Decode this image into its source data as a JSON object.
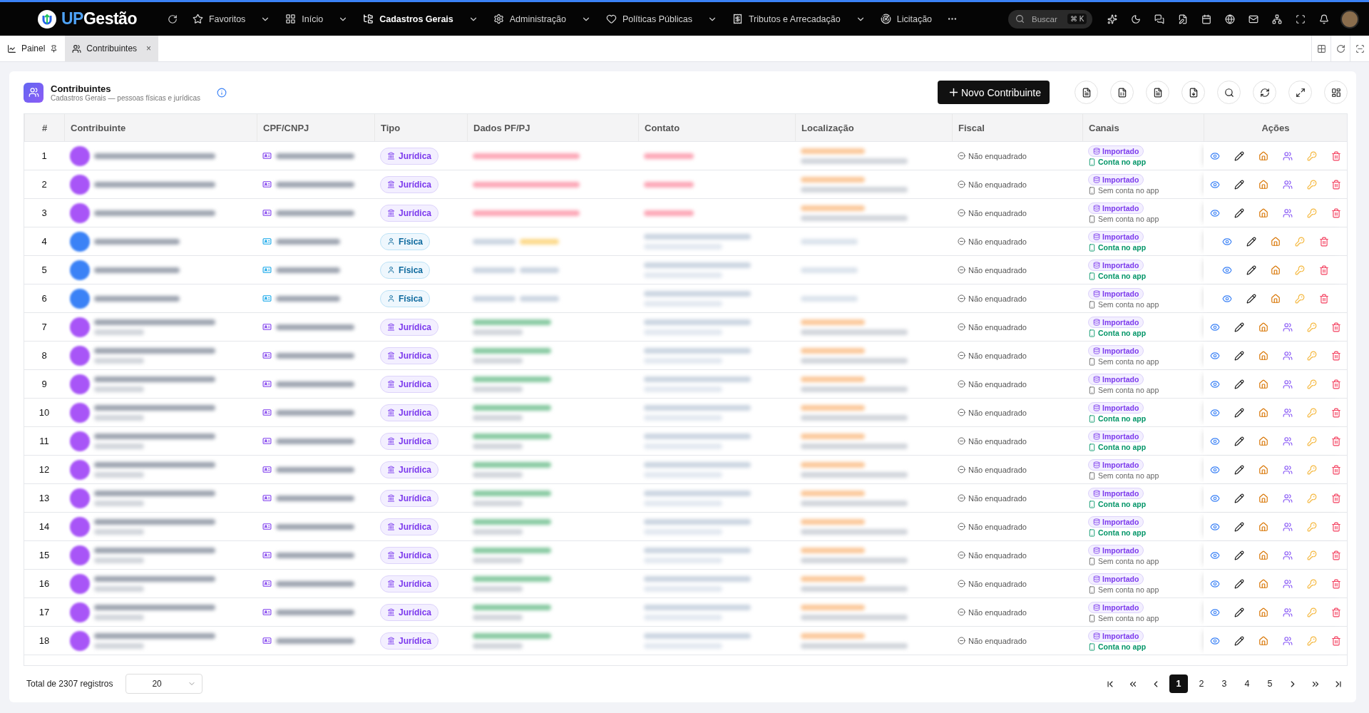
{
  "topbar": {
    "logo_prefix": "UP",
    "logo_suffix": "Gestão",
    "menu": [
      {
        "label": "Favoritos",
        "kind": "star",
        "selected": false
      },
      {
        "label": "Início",
        "kind": "grid",
        "selected": false
      },
      {
        "label": "Cadastros Gerais",
        "kind": "tree",
        "selected": true
      },
      {
        "label": "Administração",
        "kind": "gear",
        "selected": false
      },
      {
        "label": "Políticas Públicas",
        "kind": "heart",
        "selected": false
      },
      {
        "label": "Tributos e Arrecadação",
        "kind": "receipt",
        "selected": false
      },
      {
        "label": "Licitação",
        "kind": "radar",
        "selected": false
      }
    ],
    "search": {
      "placeholder": "Buscar",
      "shortcut": "⌘ K"
    }
  },
  "tabs": [
    {
      "label": "Painel",
      "kind": "pinned",
      "selected": false
    },
    {
      "label": "Contribuintes",
      "kind": "closable",
      "selected": true,
      "close": "×"
    }
  ],
  "page": {
    "title": "Contribuintes",
    "subtitle": "Cadastros Gerais — pessoas físicas e jurídicas",
    "new_button": "Novo Contribuinte"
  },
  "table": {
    "columns": [
      "#",
      "Contribuinte",
      "CPF/CNPJ",
      "Tipo",
      "Dados PF/PJ",
      "Contato",
      "Localização",
      "Fiscal",
      "Canais",
      "Ações"
    ],
    "rows": [
      {
        "number": "1",
        "tipo": {
          "kind": "juridica",
          "label": "Jurídica"
        },
        "fiscal": "Não enquadrado",
        "source": "Importado",
        "app": {
          "linked": true,
          "label": "Conta no app"
        }
      },
      {
        "number": "2",
        "tipo": {
          "kind": "juridica",
          "label": "Jurídica"
        },
        "fiscal": "Não enquadrado",
        "source": "Importado",
        "app": {
          "linked": false,
          "label": "Sem conta no app"
        }
      },
      {
        "number": "3",
        "tipo": {
          "kind": "juridica",
          "label": "Jurídica"
        },
        "fiscal": "Não enquadrado",
        "source": "Importado",
        "app": {
          "linked": false,
          "label": "Sem conta no app"
        }
      },
      {
        "number": "4",
        "tipo": {
          "kind": "fisica",
          "label": "Física"
        },
        "fiscal": "Não enquadrado",
        "source": "Importado",
        "app": {
          "linked": true,
          "label": "Conta no app"
        }
      },
      {
        "number": "5",
        "tipo": {
          "kind": "fisica",
          "label": "Física"
        },
        "fiscal": "Não enquadrado",
        "source": "Importado",
        "app": {
          "linked": true,
          "label": "Conta no app"
        }
      },
      {
        "number": "6",
        "tipo": {
          "kind": "fisica",
          "label": "Física"
        },
        "fiscal": "Não enquadrado",
        "source": "Importado",
        "app": {
          "linked": false,
          "label": "Sem conta no app"
        }
      },
      {
        "number": "7",
        "tipo": {
          "kind": "juridica",
          "label": "Jurídica"
        },
        "fiscal": "Não enquadrado",
        "source": "Importado",
        "app": {
          "linked": true,
          "label": "Conta no app"
        }
      },
      {
        "number": "8",
        "tipo": {
          "kind": "juridica",
          "label": "Jurídica"
        },
        "fiscal": "Não enquadrado",
        "source": "Importado",
        "app": {
          "linked": false,
          "label": "Sem conta no app"
        }
      },
      {
        "number": "9",
        "tipo": {
          "kind": "juridica",
          "label": "Jurídica"
        },
        "fiscal": "Não enquadrado",
        "source": "Importado",
        "app": {
          "linked": false,
          "label": "Sem conta no app"
        }
      },
      {
        "number": "10",
        "tipo": {
          "kind": "juridica",
          "label": "Jurídica"
        },
        "fiscal": "Não enquadrado",
        "source": "Importado",
        "app": {
          "linked": true,
          "label": "Conta no app"
        }
      },
      {
        "number": "11",
        "tipo": {
          "kind": "juridica",
          "label": "Jurídica"
        },
        "fiscal": "Não enquadrado",
        "source": "Importado",
        "app": {
          "linked": true,
          "label": "Conta no app"
        }
      },
      {
        "number": "12",
        "tipo": {
          "kind": "juridica",
          "label": "Jurídica"
        },
        "fiscal": "Não enquadrado",
        "source": "Importado",
        "app": {
          "linked": false,
          "label": "Sem conta no app"
        }
      },
      {
        "number": "13",
        "tipo": {
          "kind": "juridica",
          "label": "Jurídica"
        },
        "fiscal": "Não enquadrado",
        "source": "Importado",
        "app": {
          "linked": true,
          "label": "Conta no app"
        }
      },
      {
        "number": "14",
        "tipo": {
          "kind": "juridica",
          "label": "Jurídica"
        },
        "fiscal": "Não enquadrado",
        "source": "Importado",
        "app": {
          "linked": true,
          "label": "Conta no app"
        }
      },
      {
        "number": "15",
        "tipo": {
          "kind": "juridica",
          "label": "Jurídica"
        },
        "fiscal": "Não enquadrado",
        "source": "Importado",
        "app": {
          "linked": false,
          "label": "Sem conta no app"
        }
      },
      {
        "number": "16",
        "tipo": {
          "kind": "juridica",
          "label": "Jurídica"
        },
        "fiscal": "Não enquadrado",
        "source": "Importado",
        "app": {
          "linked": false,
          "label": "Sem conta no app"
        }
      },
      {
        "number": "17",
        "tipo": {
          "kind": "juridica",
          "label": "Jurídica"
        },
        "fiscal": "Não enquadrado",
        "source": "Importado",
        "app": {
          "linked": false,
          "label": "Sem conta no app"
        }
      },
      {
        "number": "18",
        "tipo": {
          "kind": "juridica",
          "label": "Jurídica"
        },
        "fiscal": "Não enquadrado",
        "source": "Importado",
        "app": {
          "linked": true,
          "label": "Conta no app"
        }
      }
    ]
  },
  "footer": {
    "total": "Total de 2307 registros",
    "page_size": "20",
    "pages": [
      {
        "label": "1",
        "selected": true
      },
      {
        "label": "2",
        "selected": false
      },
      {
        "label": "3",
        "selected": false
      },
      {
        "label": "4",
        "selected": false
      },
      {
        "label": "5",
        "selected": false
      }
    ]
  }
}
